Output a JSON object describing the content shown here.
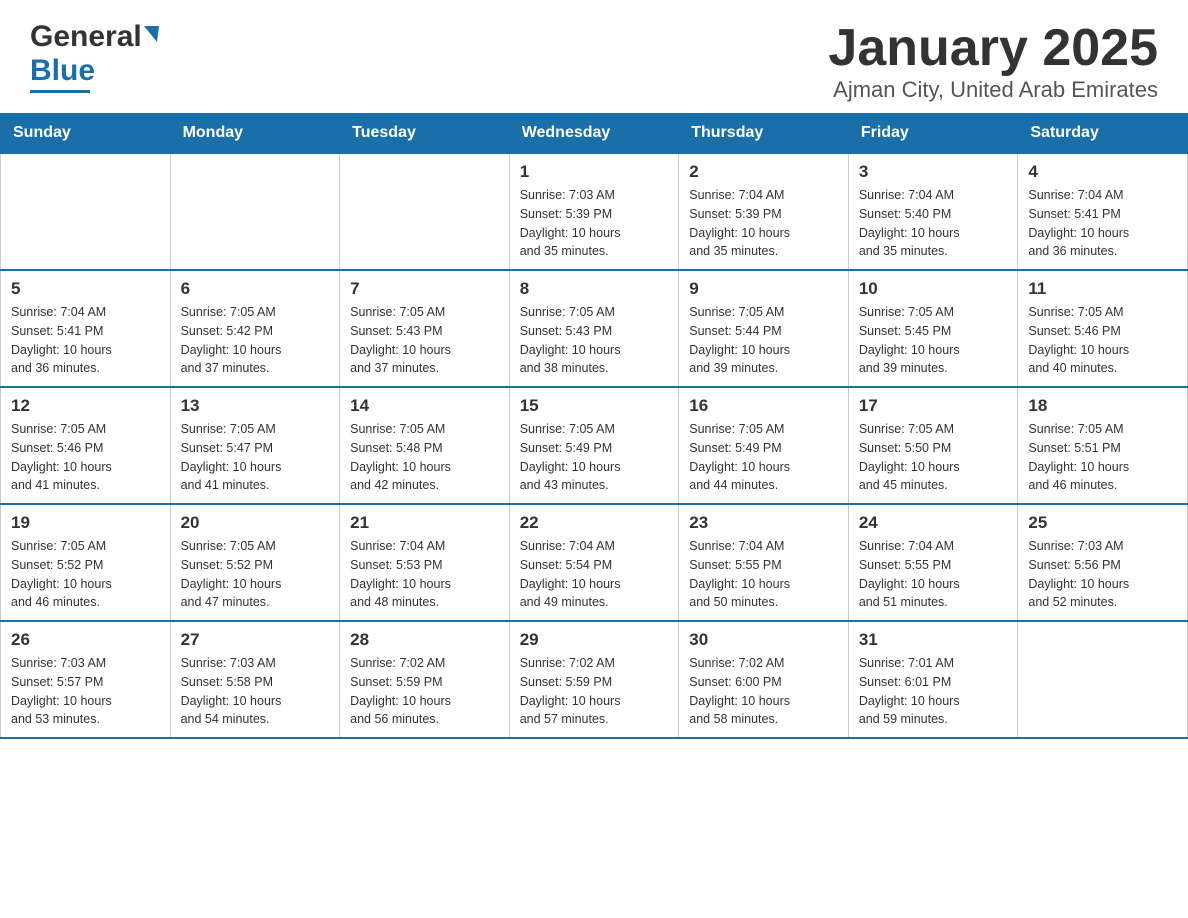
{
  "header": {
    "title": "January 2025",
    "subtitle": "Ajman City, United Arab Emirates",
    "logo_general": "General",
    "logo_blue": "Blue"
  },
  "weekdays": [
    "Sunday",
    "Monday",
    "Tuesday",
    "Wednesday",
    "Thursday",
    "Friday",
    "Saturday"
  ],
  "weeks": [
    [
      {
        "num": "",
        "info": ""
      },
      {
        "num": "",
        "info": ""
      },
      {
        "num": "",
        "info": ""
      },
      {
        "num": "1",
        "info": "Sunrise: 7:03 AM\nSunset: 5:39 PM\nDaylight: 10 hours\nand 35 minutes."
      },
      {
        "num": "2",
        "info": "Sunrise: 7:04 AM\nSunset: 5:39 PM\nDaylight: 10 hours\nand 35 minutes."
      },
      {
        "num": "3",
        "info": "Sunrise: 7:04 AM\nSunset: 5:40 PM\nDaylight: 10 hours\nand 35 minutes."
      },
      {
        "num": "4",
        "info": "Sunrise: 7:04 AM\nSunset: 5:41 PM\nDaylight: 10 hours\nand 36 minutes."
      }
    ],
    [
      {
        "num": "5",
        "info": "Sunrise: 7:04 AM\nSunset: 5:41 PM\nDaylight: 10 hours\nand 36 minutes."
      },
      {
        "num": "6",
        "info": "Sunrise: 7:05 AM\nSunset: 5:42 PM\nDaylight: 10 hours\nand 37 minutes."
      },
      {
        "num": "7",
        "info": "Sunrise: 7:05 AM\nSunset: 5:43 PM\nDaylight: 10 hours\nand 37 minutes."
      },
      {
        "num": "8",
        "info": "Sunrise: 7:05 AM\nSunset: 5:43 PM\nDaylight: 10 hours\nand 38 minutes."
      },
      {
        "num": "9",
        "info": "Sunrise: 7:05 AM\nSunset: 5:44 PM\nDaylight: 10 hours\nand 39 minutes."
      },
      {
        "num": "10",
        "info": "Sunrise: 7:05 AM\nSunset: 5:45 PM\nDaylight: 10 hours\nand 39 minutes."
      },
      {
        "num": "11",
        "info": "Sunrise: 7:05 AM\nSunset: 5:46 PM\nDaylight: 10 hours\nand 40 minutes."
      }
    ],
    [
      {
        "num": "12",
        "info": "Sunrise: 7:05 AM\nSunset: 5:46 PM\nDaylight: 10 hours\nand 41 minutes."
      },
      {
        "num": "13",
        "info": "Sunrise: 7:05 AM\nSunset: 5:47 PM\nDaylight: 10 hours\nand 41 minutes."
      },
      {
        "num": "14",
        "info": "Sunrise: 7:05 AM\nSunset: 5:48 PM\nDaylight: 10 hours\nand 42 minutes."
      },
      {
        "num": "15",
        "info": "Sunrise: 7:05 AM\nSunset: 5:49 PM\nDaylight: 10 hours\nand 43 minutes."
      },
      {
        "num": "16",
        "info": "Sunrise: 7:05 AM\nSunset: 5:49 PM\nDaylight: 10 hours\nand 44 minutes."
      },
      {
        "num": "17",
        "info": "Sunrise: 7:05 AM\nSunset: 5:50 PM\nDaylight: 10 hours\nand 45 minutes."
      },
      {
        "num": "18",
        "info": "Sunrise: 7:05 AM\nSunset: 5:51 PM\nDaylight: 10 hours\nand 46 minutes."
      }
    ],
    [
      {
        "num": "19",
        "info": "Sunrise: 7:05 AM\nSunset: 5:52 PM\nDaylight: 10 hours\nand 46 minutes."
      },
      {
        "num": "20",
        "info": "Sunrise: 7:05 AM\nSunset: 5:52 PM\nDaylight: 10 hours\nand 47 minutes."
      },
      {
        "num": "21",
        "info": "Sunrise: 7:04 AM\nSunset: 5:53 PM\nDaylight: 10 hours\nand 48 minutes."
      },
      {
        "num": "22",
        "info": "Sunrise: 7:04 AM\nSunset: 5:54 PM\nDaylight: 10 hours\nand 49 minutes."
      },
      {
        "num": "23",
        "info": "Sunrise: 7:04 AM\nSunset: 5:55 PM\nDaylight: 10 hours\nand 50 minutes."
      },
      {
        "num": "24",
        "info": "Sunrise: 7:04 AM\nSunset: 5:55 PM\nDaylight: 10 hours\nand 51 minutes."
      },
      {
        "num": "25",
        "info": "Sunrise: 7:03 AM\nSunset: 5:56 PM\nDaylight: 10 hours\nand 52 minutes."
      }
    ],
    [
      {
        "num": "26",
        "info": "Sunrise: 7:03 AM\nSunset: 5:57 PM\nDaylight: 10 hours\nand 53 minutes."
      },
      {
        "num": "27",
        "info": "Sunrise: 7:03 AM\nSunset: 5:58 PM\nDaylight: 10 hours\nand 54 minutes."
      },
      {
        "num": "28",
        "info": "Sunrise: 7:02 AM\nSunset: 5:59 PM\nDaylight: 10 hours\nand 56 minutes."
      },
      {
        "num": "29",
        "info": "Sunrise: 7:02 AM\nSunset: 5:59 PM\nDaylight: 10 hours\nand 57 minutes."
      },
      {
        "num": "30",
        "info": "Sunrise: 7:02 AM\nSunset: 6:00 PM\nDaylight: 10 hours\nand 58 minutes."
      },
      {
        "num": "31",
        "info": "Sunrise: 7:01 AM\nSunset: 6:01 PM\nDaylight: 10 hours\nand 59 minutes."
      },
      {
        "num": "",
        "info": ""
      }
    ]
  ]
}
